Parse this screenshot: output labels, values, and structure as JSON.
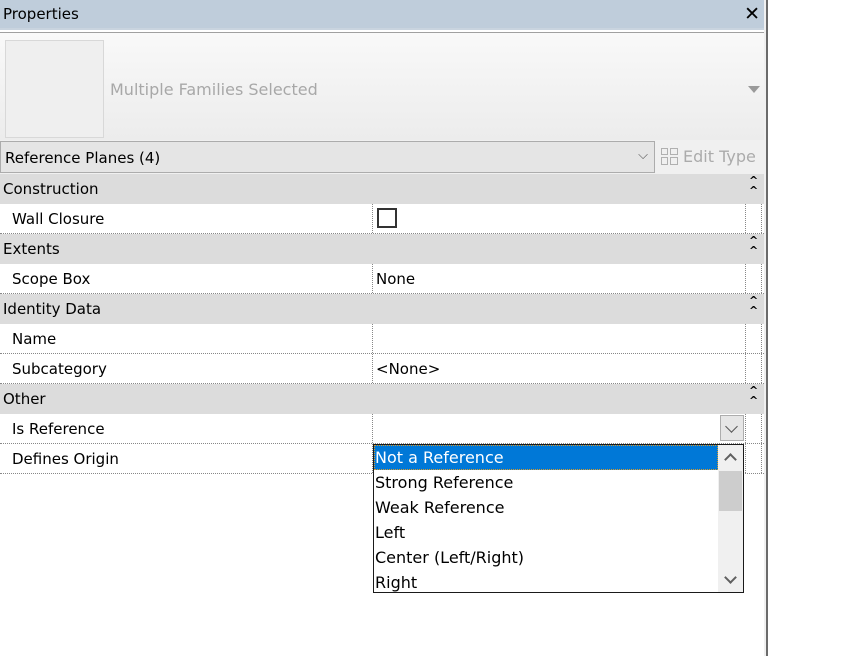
{
  "panel": {
    "title": "Properties",
    "close_icon": "close-x-icon"
  },
  "type_selector": {
    "name": "Multiple Families Selected",
    "dropdown_icon": "triangle-down-icon"
  },
  "filter": {
    "value": "Reference Planes (4)",
    "chevron_icon": "chevron-down-icon"
  },
  "edit_type": {
    "label": "Edit Type",
    "icon": "edit-type-icon",
    "enabled": false
  },
  "groups": [
    {
      "label": "Construction",
      "collapse_icon": "double-chevron-up-icon",
      "rows": [
        {
          "name": "Wall Closure",
          "type": "checkbox",
          "checked": false,
          "value": ""
        }
      ]
    },
    {
      "label": "Extents",
      "collapse_icon": "double-chevron-up-icon",
      "rows": [
        {
          "name": "Scope Box",
          "type": "text",
          "value": "None"
        }
      ]
    },
    {
      "label": "Identity Data",
      "collapse_icon": "double-chevron-up-icon",
      "rows": [
        {
          "name": "Name",
          "type": "text",
          "value": ""
        },
        {
          "name": "Subcategory",
          "type": "text",
          "value": "<None>"
        }
      ]
    },
    {
      "label": "Other",
      "collapse_icon": "double-chevron-up-icon",
      "rows": [
        {
          "name": "Is Reference",
          "type": "combo",
          "value": ""
        },
        {
          "name": "Defines Origin",
          "type": "text",
          "value": ""
        }
      ]
    }
  ],
  "dropdown": {
    "selected": "Not a Reference",
    "options": [
      "Not a Reference",
      "Strong Reference",
      "Weak Reference",
      "Left",
      "Center (Left/Right)",
      "Right"
    ],
    "scroll_up_icon": "chevron-up-icon",
    "scroll_down_icon": "chevron-down-icon"
  },
  "colors": {
    "titlebar": "#bfcddb",
    "group_header": "#dcdcdc",
    "selection": "#0078d7"
  }
}
